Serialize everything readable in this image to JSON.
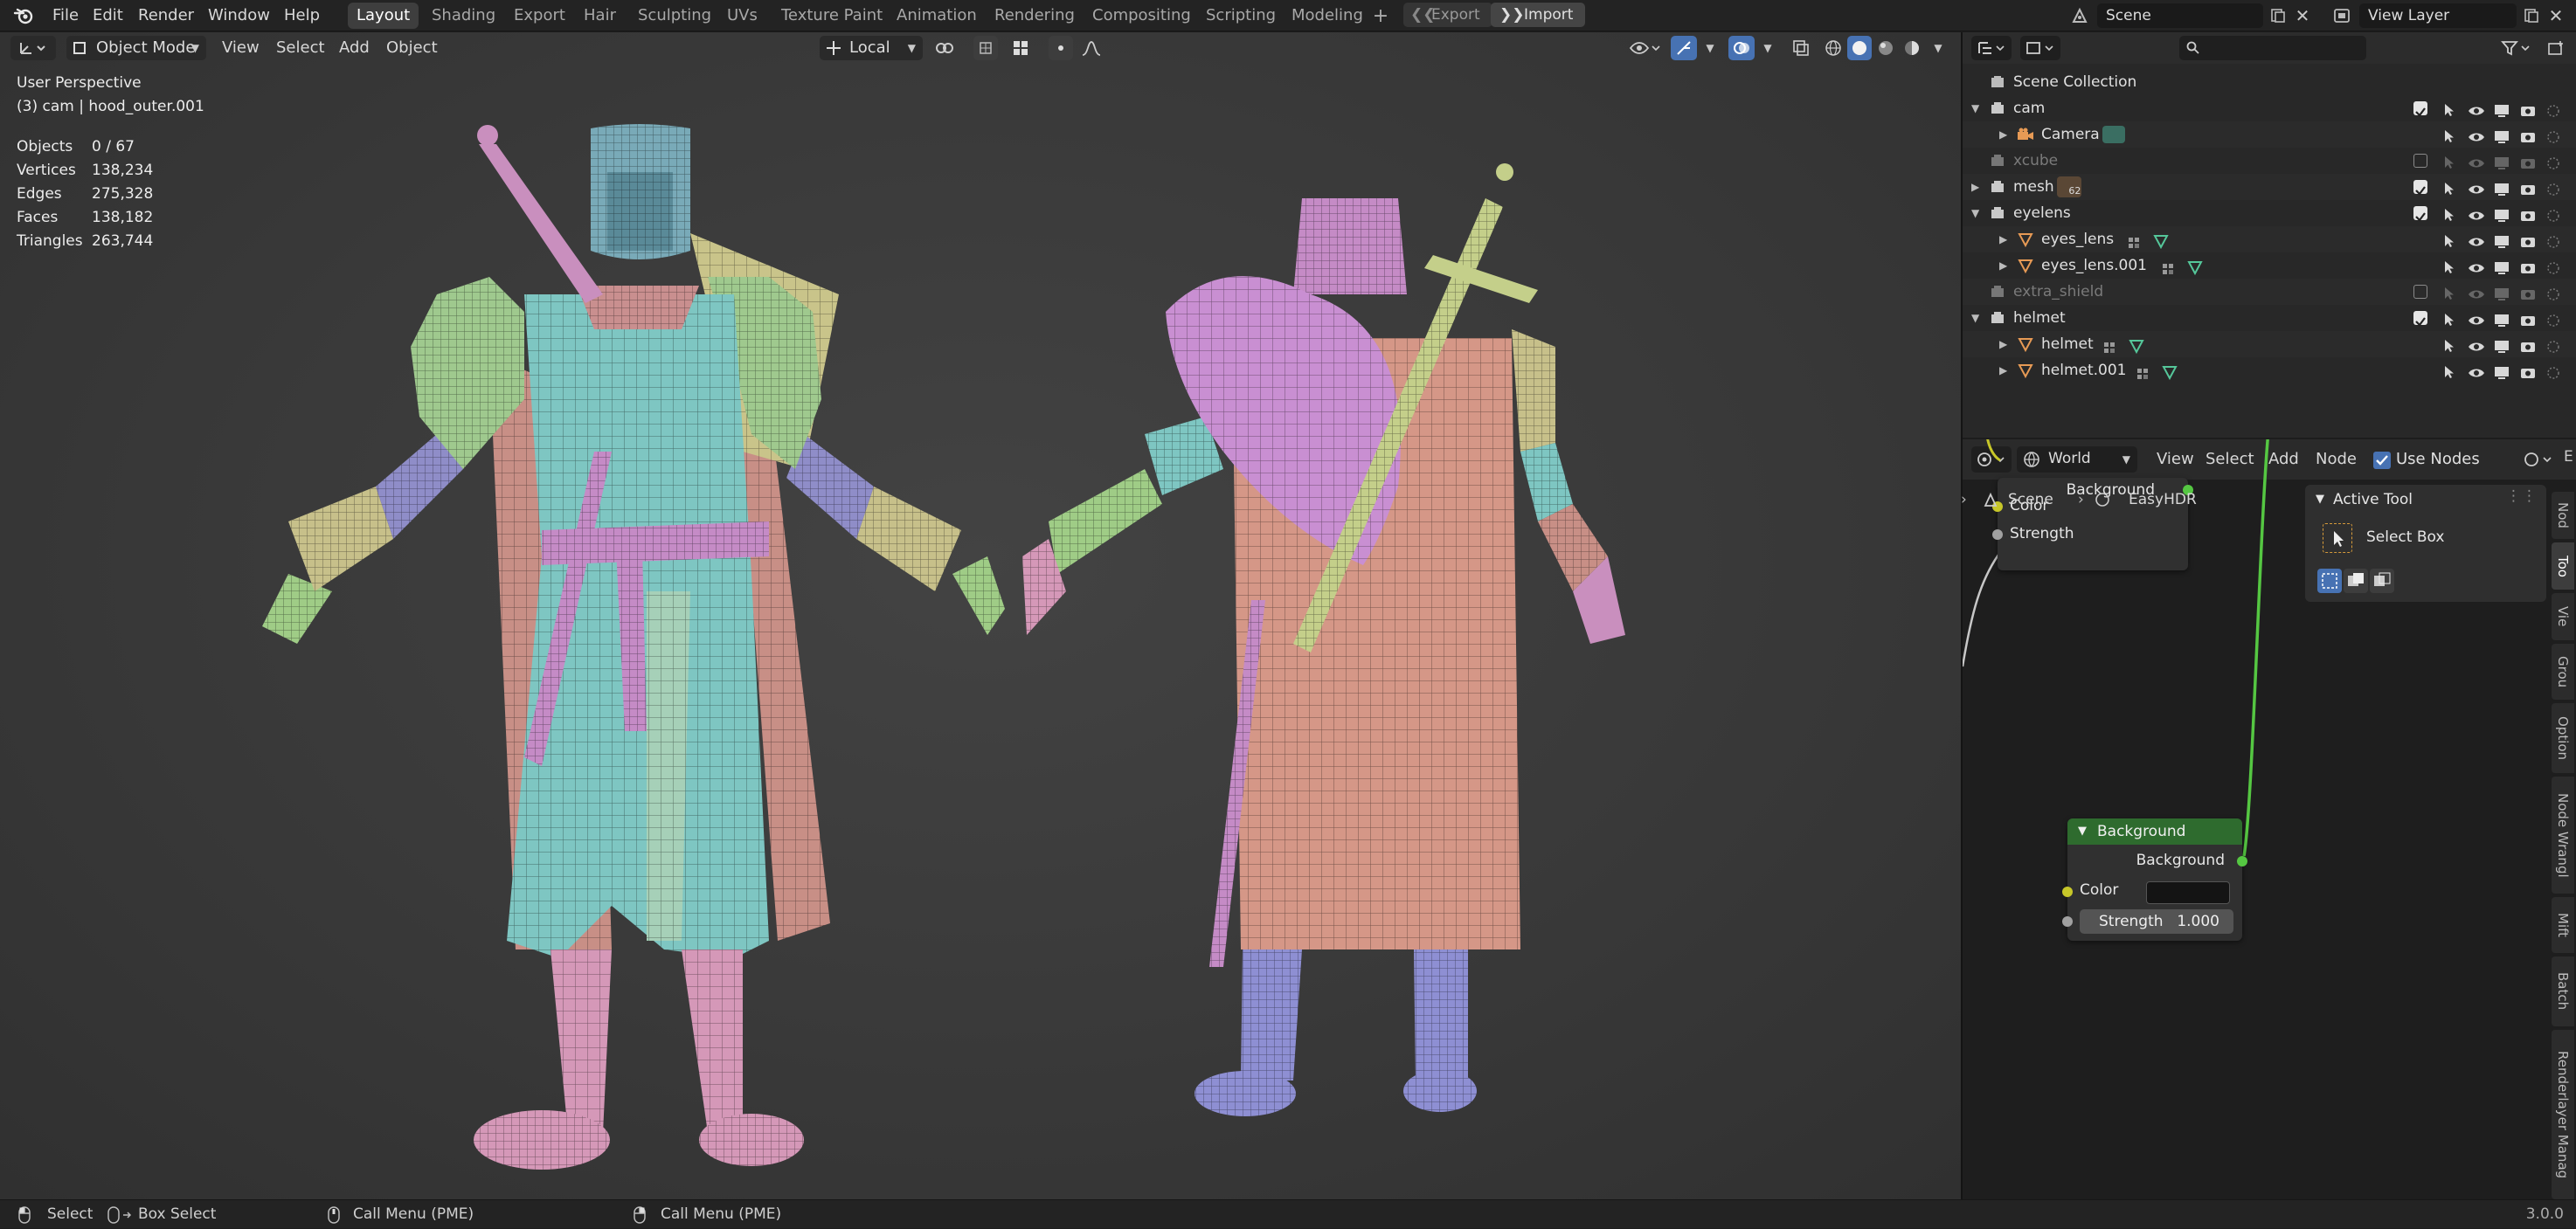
{
  "topbar": {
    "menus": [
      "File",
      "Edit",
      "Render",
      "Window",
      "Help"
    ],
    "workspaces": [
      "Layout",
      "Shading",
      "Export",
      "Hair",
      "Sculpting",
      "UVs",
      "Texture Paint",
      "Animation",
      "Rendering",
      "Compositing",
      "Scripting",
      "Modeling"
    ],
    "active_workspace": "Layout",
    "export_label": "Export",
    "import_label": "Import",
    "scene": "Scene",
    "view_layer": "View Layer"
  },
  "viewport": {
    "mode": "Object Mode",
    "menus": [
      "View",
      "Select",
      "Add",
      "Object"
    ],
    "orientation": "Local",
    "perspective": "User Perspective",
    "active_object": "(3) cam | hood_outer.001",
    "stats": [
      {
        "label": "Objects",
        "value": "0 / 67"
      },
      {
        "label": "Vertices",
        "value": "138,234"
      },
      {
        "label": "Edges",
        "value": "275,328"
      },
      {
        "label": "Faces",
        "value": "138,182"
      },
      {
        "label": "Triangles",
        "value": "263,744"
      }
    ]
  },
  "outliner": {
    "root": "Scene Collection",
    "rows": [
      {
        "name": "cam",
        "kind": "collection",
        "indent": 1,
        "expanded": true,
        "muted": false,
        "checked": true
      },
      {
        "name": "Camera",
        "kind": "camera",
        "indent": 2,
        "expanded": false,
        "muted": false,
        "checked": null
      },
      {
        "name": "xcube",
        "kind": "collection",
        "indent": 1,
        "expanded": false,
        "muted": true,
        "checked": false
      },
      {
        "name": "mesh",
        "kind": "collection",
        "indent": 1,
        "expanded": false,
        "muted": false,
        "checked": true,
        "badge": "62"
      },
      {
        "name": "eyelens",
        "kind": "collection",
        "indent": 1,
        "expanded": true,
        "muted": false,
        "checked": true
      },
      {
        "name": "eyes_lens",
        "kind": "mesh",
        "indent": 2,
        "expanded": false,
        "muted": false,
        "checked": null
      },
      {
        "name": "eyes_lens.001",
        "kind": "mesh",
        "indent": 2,
        "expanded": false,
        "muted": false,
        "checked": null
      },
      {
        "name": "extra_shield",
        "kind": "collection",
        "indent": 1,
        "expanded": false,
        "muted": true,
        "checked": false
      },
      {
        "name": "helmet",
        "kind": "collection",
        "indent": 1,
        "expanded": true,
        "muted": false,
        "checked": true
      },
      {
        "name": "helmet",
        "kind": "mesh",
        "indent": 2,
        "expanded": false,
        "muted": false,
        "checked": null
      },
      {
        "name": "helmet.001",
        "kind": "mesh",
        "indent": 2,
        "expanded": false,
        "muted": false,
        "checked": null
      }
    ]
  },
  "node_editor": {
    "world": "World",
    "menus": [
      "View",
      "Select",
      "Add",
      "Node"
    ],
    "use_nodes_label": "Use Nodes",
    "breadcrumb": [
      "Scene",
      "EasyHDR"
    ],
    "top_node": {
      "output": "Background",
      "inputs": [
        "Color",
        "Strength"
      ]
    },
    "bg_node": {
      "title": "Background",
      "output": "Background",
      "color_label": "Color",
      "strength_label": "Strength",
      "strength_value": "1.000",
      "color_value": "#141414"
    },
    "active_tool": {
      "title": "Active Tool",
      "tool": "Select Box"
    },
    "side_tabs": [
      "Nod",
      "Too",
      "Vie",
      "Grou",
      "Option",
      "Node Wrangl",
      "Mift",
      "Batch",
      "Renderlayer Manag"
    ],
    "side_tab_active": "Too",
    "cut_label": "E"
  },
  "statusbar": {
    "items": [
      "Select",
      "Box Select",
      "Call Menu (PME)",
      "Call Menu (PME)"
    ],
    "version": "3.0.0"
  },
  "colors": {
    "accent": "#4772b3",
    "node_header_green": "#2e6b2e",
    "wire_green": "#55c742",
    "socket_yellow": "#c7c729",
    "socket_gray": "#a1a1a1"
  }
}
